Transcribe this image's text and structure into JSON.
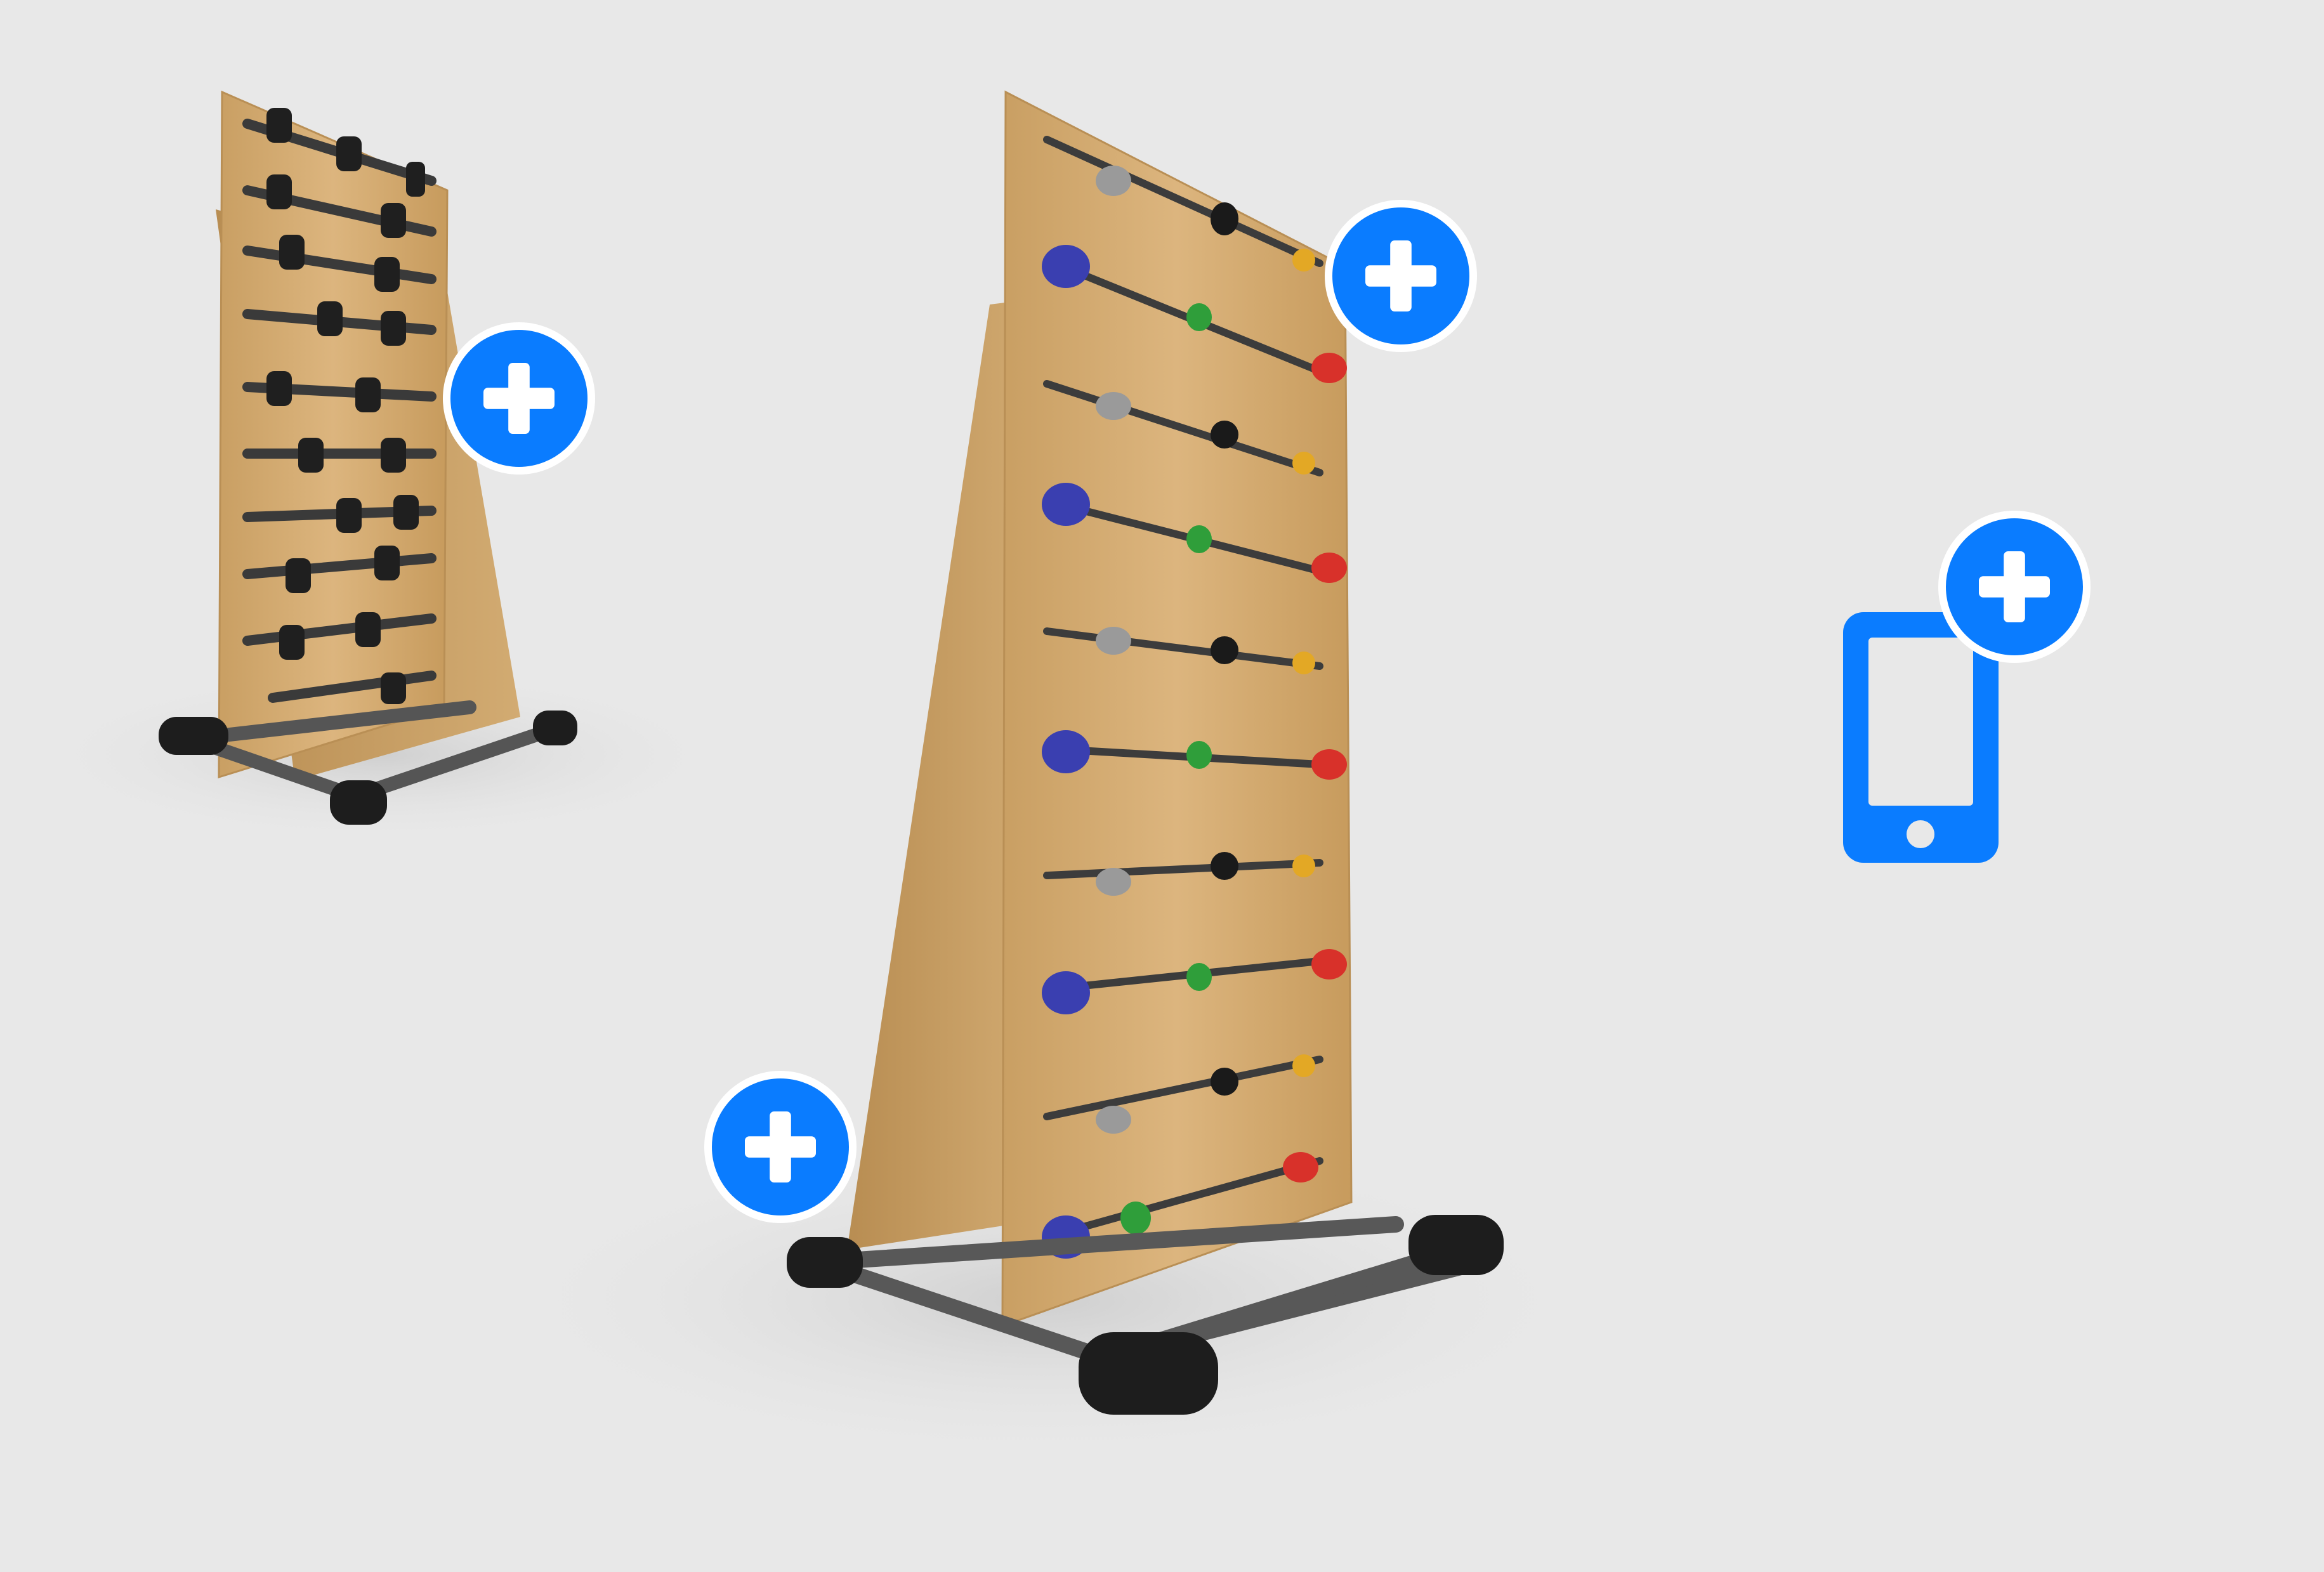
{
  "scene": {
    "background_color": "#e8e8e8",
    "accent_color": "#0a7cff",
    "wood_color": "#d2ab72",
    "frame_color": "#2b2b2b",
    "hold_colors": [
      "#3a3fb0",
      "#2f9e3a",
      "#d8312a",
      "#e3a825",
      "#1a1a1a",
      "#9a9a9a"
    ]
  },
  "icons": {
    "plus": "plus-circle-icon",
    "phone": "smartphone-icon"
  }
}
